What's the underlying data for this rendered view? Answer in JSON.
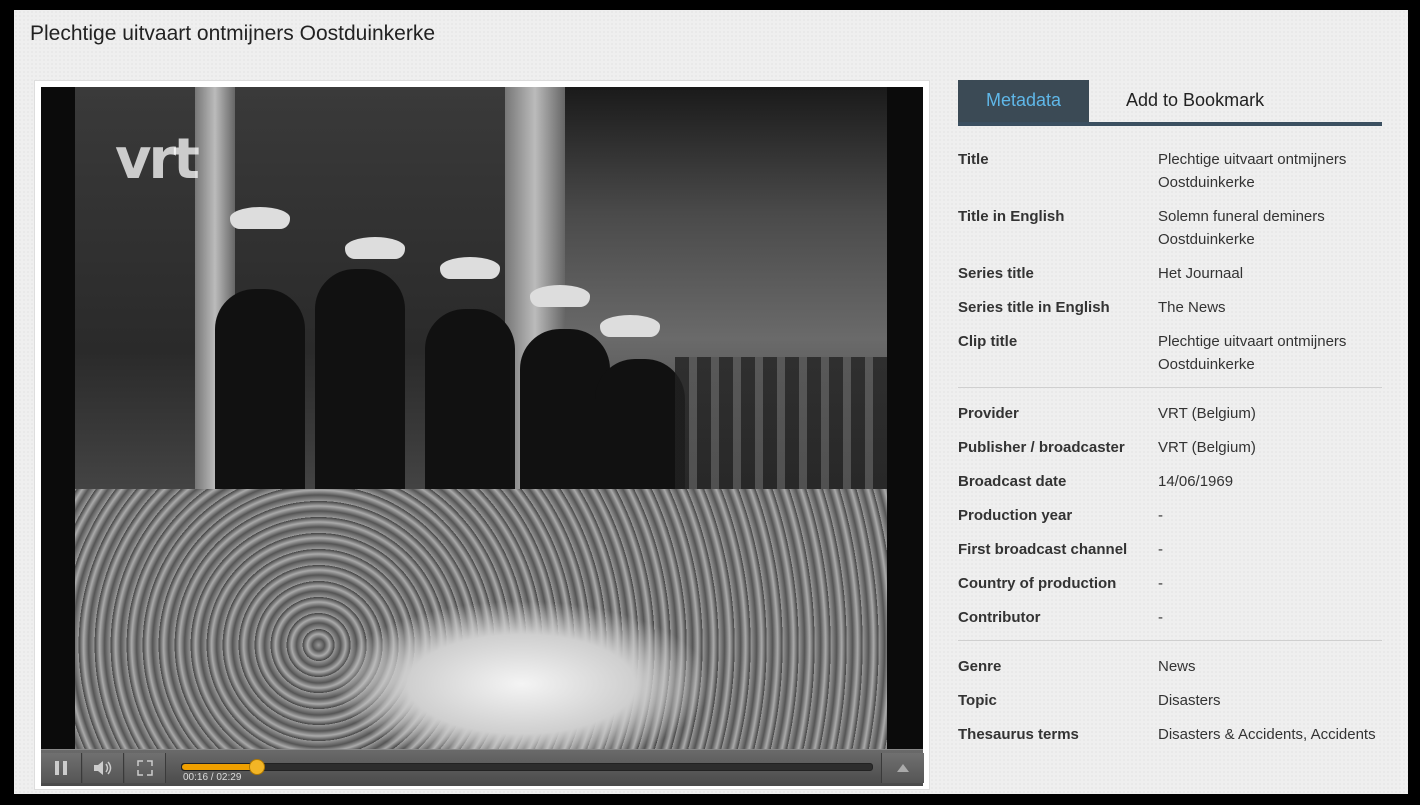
{
  "page": {
    "title": "Plechtige uitvaart ontmijners Oostduinkerke"
  },
  "player": {
    "logo_text": "vrt",
    "time_display": "00:16 / 02:29",
    "progress_fraction": 0.1074,
    "icons": {
      "pause": "pause-icon",
      "volume": "volume-icon",
      "fullscreen": "fullscreen-icon",
      "expand": "expand-up-icon"
    }
  },
  "tabs": [
    {
      "label": "Metadata",
      "active": true
    },
    {
      "label": "Add to Bookmark",
      "active": false
    }
  ],
  "metadata": {
    "group1": [
      {
        "key": "Title",
        "value": "Plechtige uitvaart ontmijners Oostduinkerke"
      },
      {
        "key": "Title in English",
        "value": "Solemn funeral deminers Oostduinkerke"
      },
      {
        "key": "Series title",
        "value": "Het Journaal"
      },
      {
        "key": "Series title in English",
        "value": "The News"
      },
      {
        "key": "Clip title",
        "value": "Plechtige uitvaart ontmijners Oostduinkerke"
      }
    ],
    "group2": [
      {
        "key": "Provider",
        "value": "VRT (Belgium)"
      },
      {
        "key": "Publisher / broadcaster",
        "value": "VRT (Belgium)"
      },
      {
        "key": "Broadcast date",
        "value": "14/06/1969"
      },
      {
        "key": "Production year",
        "value": "-"
      },
      {
        "key": "First broadcast channel",
        "value": "-"
      },
      {
        "key": "Country of production",
        "value": "-"
      },
      {
        "key": "Contributor",
        "value": "-"
      }
    ],
    "group3": [
      {
        "key": "Genre",
        "value": "News"
      },
      {
        "key": "Topic",
        "value": "Disasters"
      },
      {
        "key": "Thesaurus terms",
        "value": "Disasters & Accidents, Accidents"
      }
    ]
  },
  "colors": {
    "accent": "#f0a000",
    "tab_active_bg": "#3b4a55",
    "tab_active_text": "#5fb7e8"
  }
}
